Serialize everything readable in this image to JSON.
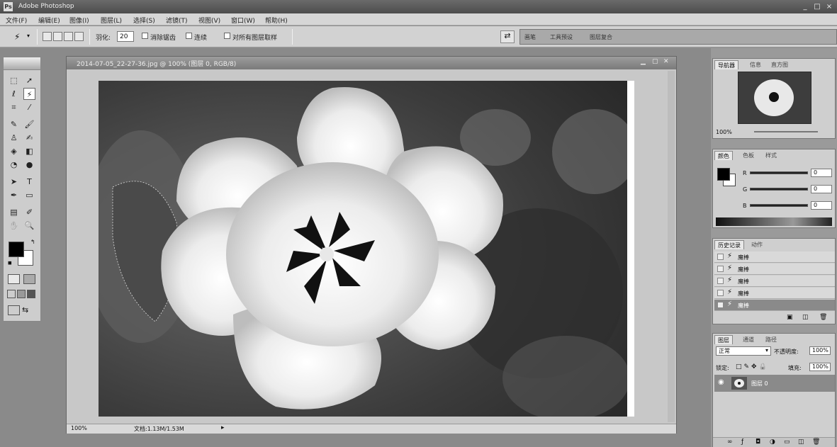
{
  "window": {
    "title": "Adobe Photoshop",
    "app_icon": "Ps",
    "min": "_",
    "max": "□",
    "close": "×"
  },
  "menu": [
    "文件(F)",
    "编辑(E)",
    "图像(I)",
    "图层(L)",
    "选择(S)",
    "滤镜(T)",
    "视图(V)",
    "窗口(W)",
    "帮助(H)"
  ],
  "options": {
    "feather_label": "羽化:",
    "feather_value": "20",
    "antialias_label": "消除锯齿",
    "continuous_label": "连续",
    "sample_all_label": "对所有图层取样",
    "palette_tabs": [
      "画笔",
      "工具预设",
      "图层复合"
    ]
  },
  "document": {
    "title": "2014-07-05_22-27-36.jpg @ 100% (图层 0, RGB/8)",
    "zoom": "100%",
    "doc_size": "文档:1.13M/1.53M"
  },
  "navigator": {
    "tabs": [
      "导航器",
      "信息",
      "直方图"
    ],
    "zoom": "100%"
  },
  "color": {
    "tabs": [
      "颜色",
      "色板",
      "样式"
    ],
    "channels": [
      {
        "label": "R",
        "value": "0"
      },
      {
        "label": "G",
        "value": "0"
      },
      {
        "label": "B",
        "value": "0"
      }
    ]
  },
  "history": {
    "tabs": [
      "历史记录",
      "动作"
    ],
    "items": [
      "魔棒",
      "魔棒",
      "魔棒",
      "魔棒",
      "魔棒"
    ],
    "selected_index": 4
  },
  "layers": {
    "tabs": [
      "图层",
      "通道",
      "路径"
    ],
    "blend_mode": "正常",
    "opacity_label": "不透明度:",
    "opacity_value": "100%",
    "lock_label": "锁定:",
    "fill_label": "填充:",
    "fill_value": "100%",
    "layer_name": "图层 0"
  },
  "colors": {
    "bg": "#8f8f8f",
    "panel": "#cfcfcf",
    "selected": "#8a8a8a"
  }
}
